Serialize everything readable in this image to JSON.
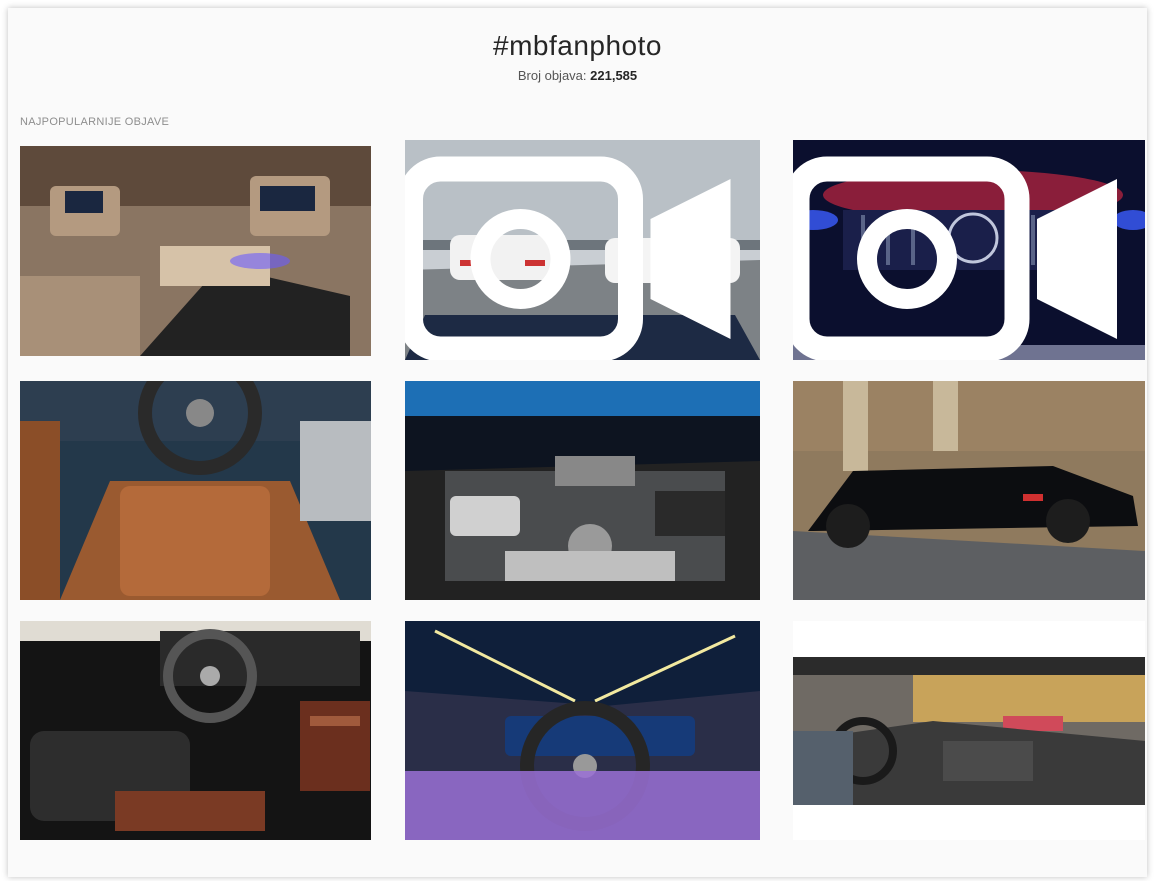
{
  "header": {
    "hashtag": "#mbfanphoto",
    "count_label": "Broj objava:",
    "count_value": "221,585"
  },
  "section": {
    "label": "NAJPOPULARNIJE OBJAVE"
  },
  "posts": [
    {
      "kind": "photo",
      "icon": null
    },
    {
      "kind": "video",
      "icon": "video-camera-icon"
    },
    {
      "kind": "video",
      "icon": "video-camera-icon"
    },
    {
      "kind": "photo",
      "icon": null
    },
    {
      "kind": "photo",
      "icon": null
    },
    {
      "kind": "photo",
      "icon": null
    },
    {
      "kind": "photo",
      "icon": null
    },
    {
      "kind": "photo",
      "icon": null
    },
    {
      "kind": "photo",
      "icon": null
    }
  ]
}
